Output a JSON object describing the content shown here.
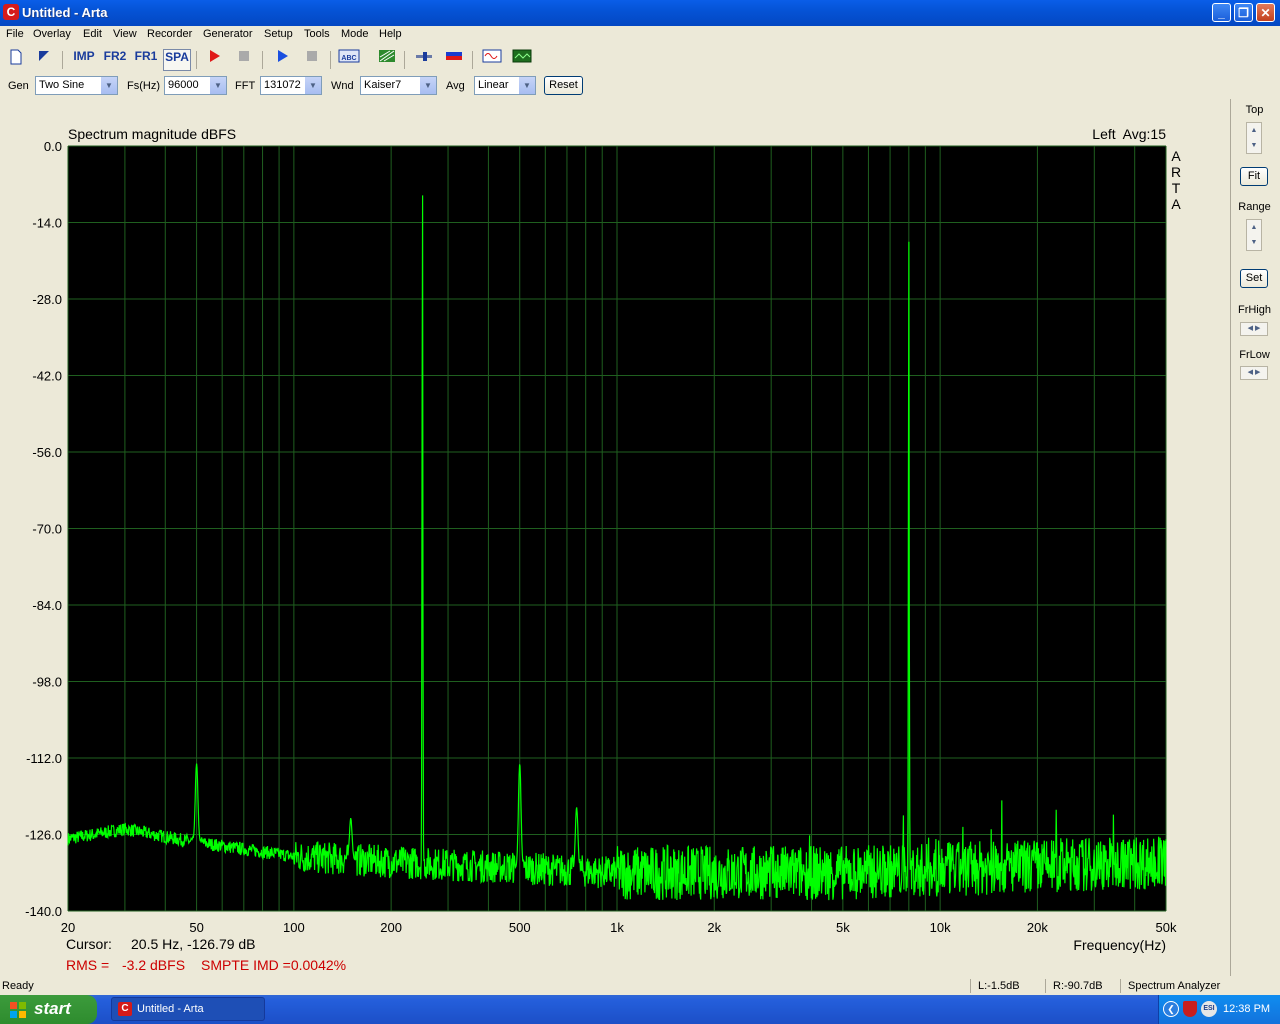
{
  "window": {
    "title": "Untitled - Arta",
    "app_icon": "arta-logo-icon"
  },
  "menu": [
    "File",
    "Overlay",
    "Edit",
    "View",
    "Recorder",
    "Generator",
    "Setup",
    "Tools",
    "Mode",
    "Help"
  ],
  "toolbar": {
    "imp": "IMP",
    "fr2": "FR2",
    "fr1": "FR1",
    "spa": "SPA"
  },
  "genbar": {
    "gen_label": "Gen",
    "gen_value": "Two Sine",
    "fs_label": "Fs(Hz)",
    "fs_value": "96000",
    "fft_label": "FFT",
    "fft_value": "131072",
    "wnd_label": "Wnd",
    "wnd_value": "Kaiser7",
    "avg_label": "Avg",
    "avg_value": "Linear",
    "reset": "Reset"
  },
  "side": {
    "top": "Top",
    "fit": "Fit",
    "range": "Range",
    "set": "Set",
    "frhigh": "FrHigh",
    "frlow": "FrLow"
  },
  "plot": {
    "cursor_label": "Cursor:",
    "cursor_value": "20.5 Hz, -126.79 dB",
    "rms_label": "RMS =",
    "rms_value": "-3.2 dBFS",
    "imd": "SMPTE IMD =0.0042%"
  },
  "chart_data": {
    "type": "line",
    "title": "Spectrum magnitude dBFS",
    "channel_info": "Left  Avg:15",
    "watermark": "ARTA",
    "xlabel": "Frequency(Hz)",
    "ylabel": "",
    "xscale": "log",
    "xlim": [
      20,
      50000
    ],
    "ylim": [
      -140,
      0
    ],
    "y_ticks": [
      "0.0",
      "-14.0",
      "-28.0",
      "-42.0",
      "-56.0",
      "-70.0",
      "-84.0",
      "-98.0",
      "-112.0",
      "-126.0",
      "-140.0"
    ],
    "x_ticks": [
      "20",
      "50",
      "100",
      "200",
      "500",
      "1k",
      "2k",
      "5k",
      "10k",
      "20k",
      "50k"
    ],
    "x_tick_values": [
      20,
      50,
      100,
      200,
      500,
      1000,
      2000,
      5000,
      10000,
      20000,
      50000
    ],
    "grid": true,
    "series_color": "#00ff00",
    "peaks": [
      {
        "x": 50,
        "y": -113
      },
      {
        "x": 150,
        "y": -123
      },
      {
        "x": 250,
        "y": -4
      },
      {
        "x": 500,
        "y": -113
      },
      {
        "x": 750,
        "y": -121
      },
      {
        "x": 8000,
        "y": -16
      }
    ],
    "noise_floor": [
      {
        "x": 20,
        "y": -126.8
      },
      {
        "x": 30,
        "y": -125
      },
      {
        "x": 45,
        "y": -127
      },
      {
        "x": 100,
        "y": -130
      },
      {
        "x": 200,
        "y": -131
      },
      {
        "x": 1000,
        "y": -133
      },
      {
        "x": 5000,
        "y": -133
      },
      {
        "x": 50000,
        "y": -131
      }
    ]
  },
  "status": {
    "ready": "Ready",
    "left_level": "L:-1.5dB",
    "right_level": "R:-90.7dB",
    "mode": "Spectrum Analyzer"
  },
  "taskbar": {
    "start": "start",
    "task": "Untitled - Arta",
    "clock": "12:38 PM"
  }
}
